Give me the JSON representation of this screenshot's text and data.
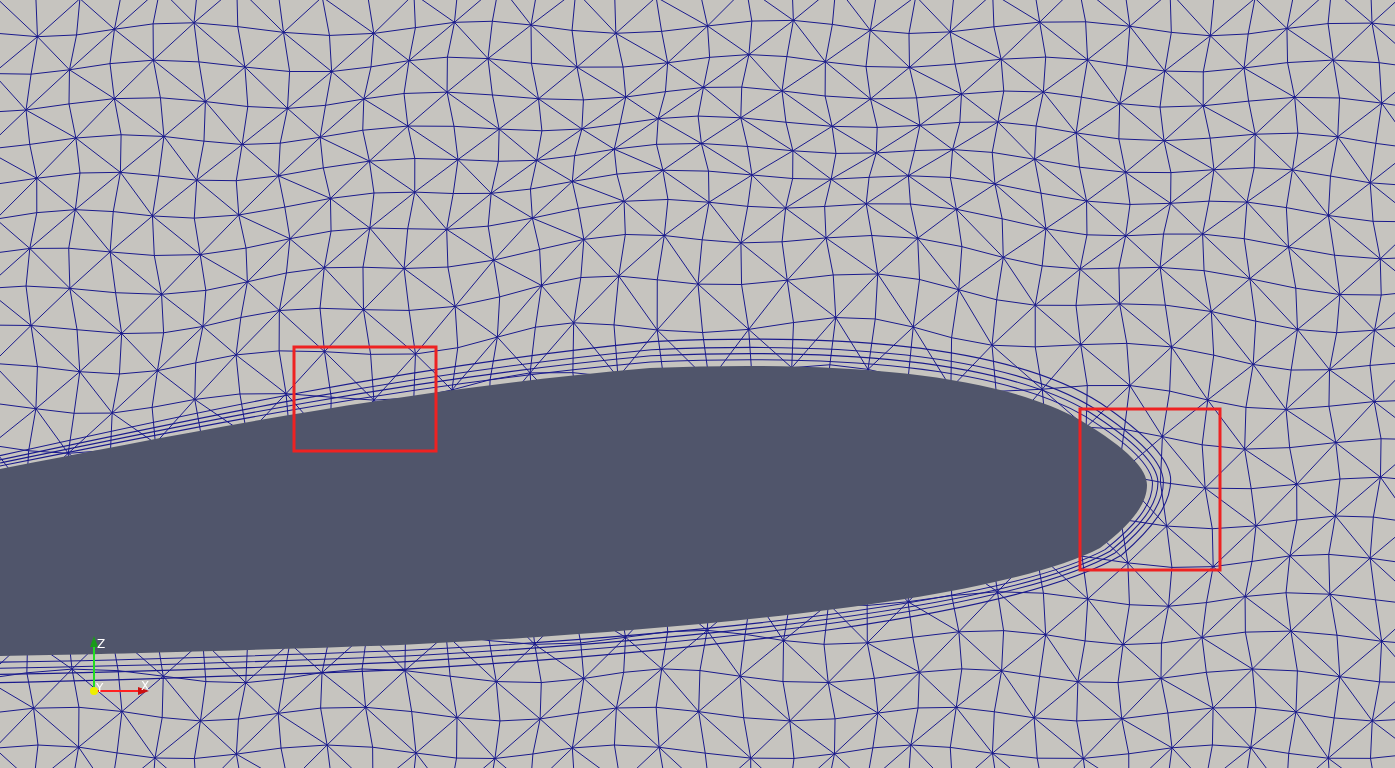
{
  "orientation_axes": {
    "z_label": "Z",
    "y_label": "Y",
    "x_label": "X"
  }
}
